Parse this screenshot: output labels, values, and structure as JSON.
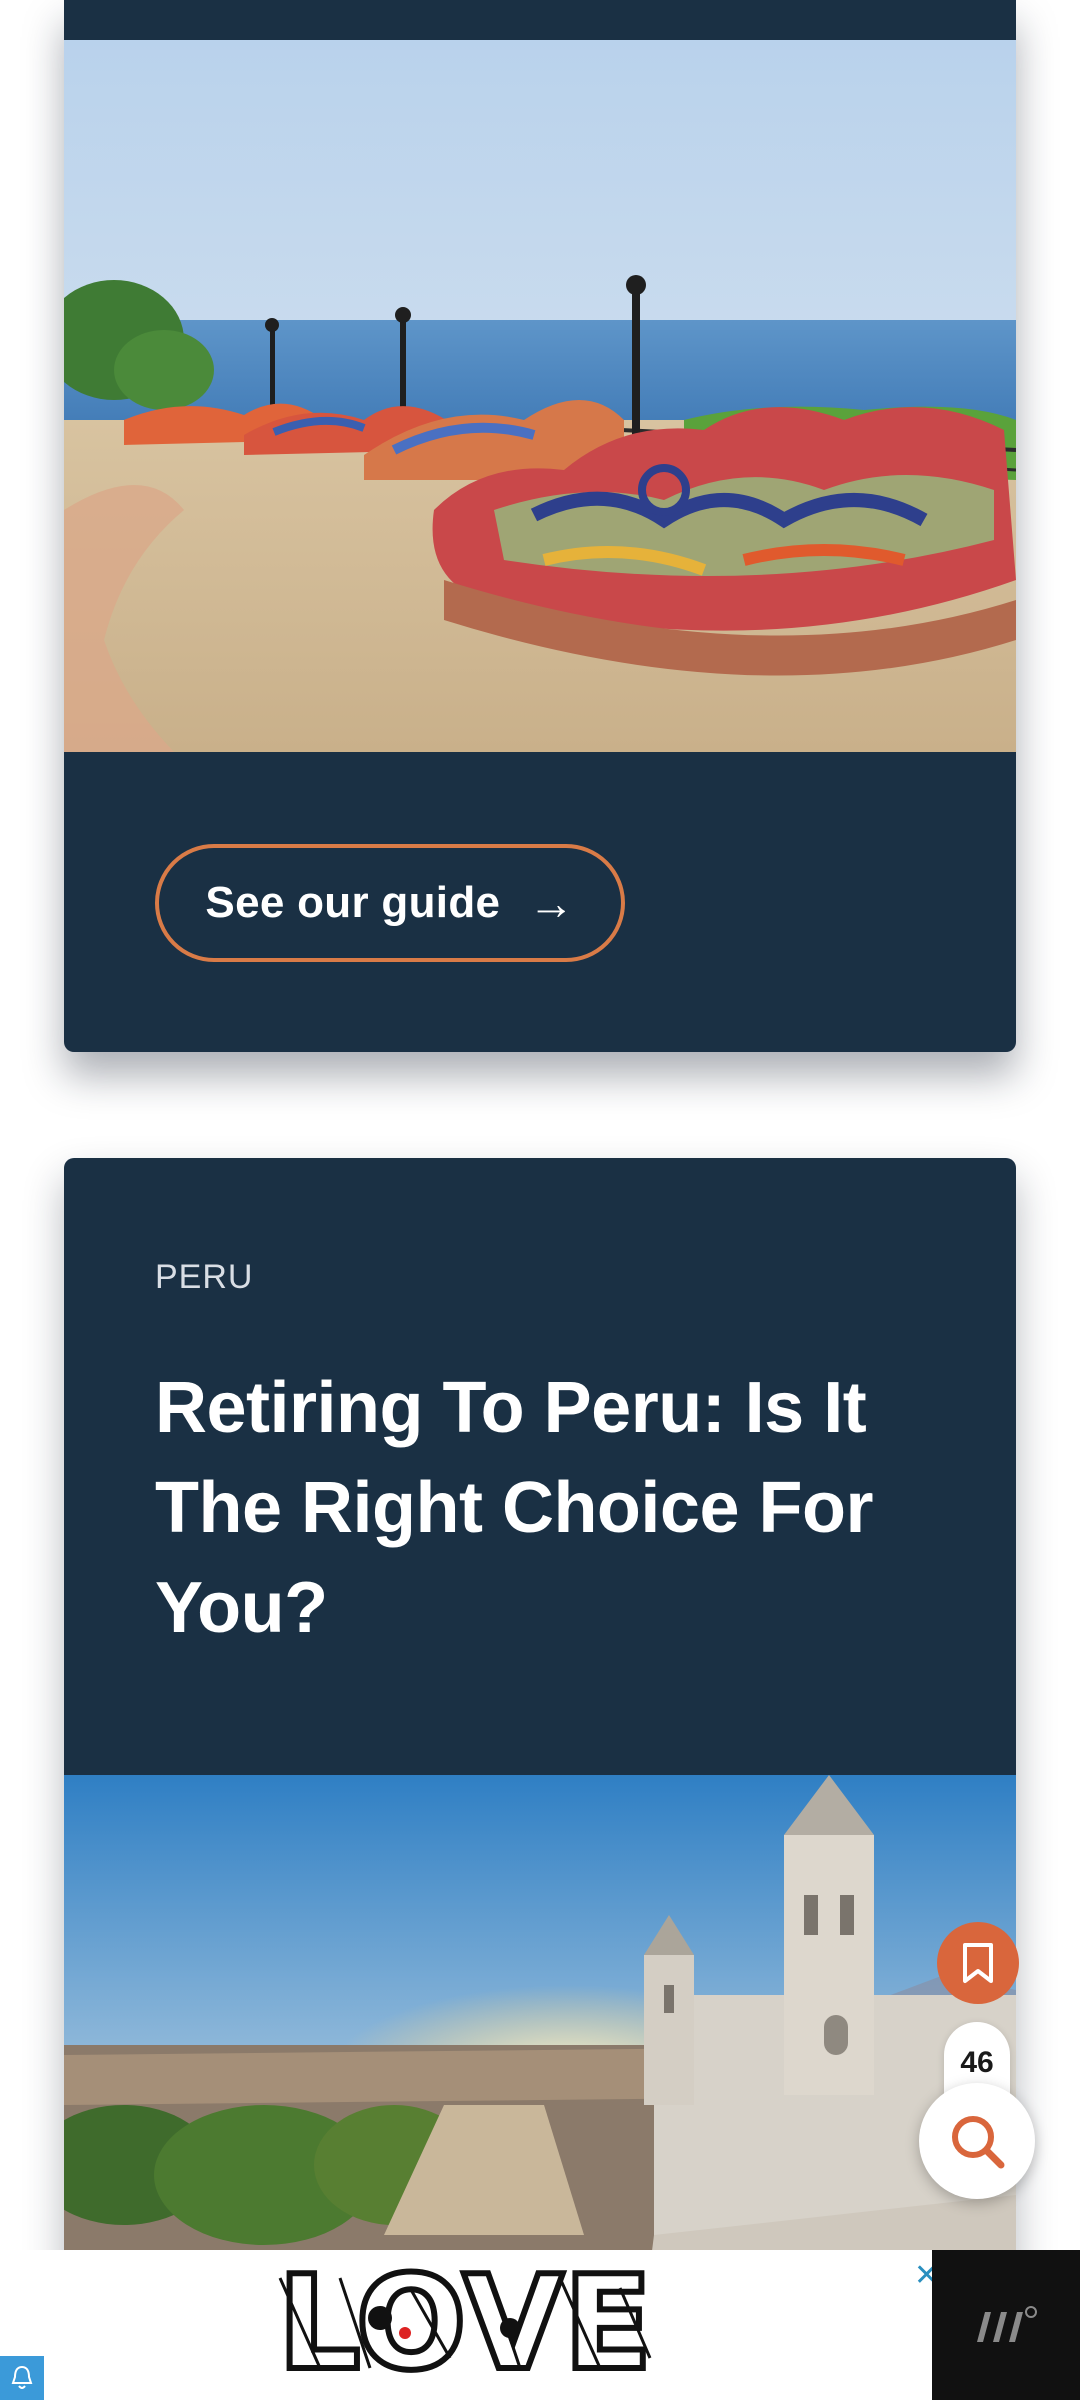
{
  "card1": {
    "button_label": "See our guide",
    "button_arrow": "→",
    "image": "mosaic-bench-park-ocean"
  },
  "card2": {
    "category": "PERU",
    "title": "Retiring To Peru: Is It The Right Choice For You?",
    "image": "cathedral-plaza-sunset"
  },
  "floating": {
    "bookmark_icon": "bookmark-icon",
    "count": "46",
    "search_icon": "search-icon"
  },
  "ad": {
    "label": "LOVE",
    "close_symbol": "✕",
    "brand_icon": "brand-logo-icon",
    "notify_icon": "bell-icon"
  },
  "colors": {
    "card_bg": "#1a3044",
    "accent": "#d9663c",
    "button_border": "#d97b47"
  }
}
